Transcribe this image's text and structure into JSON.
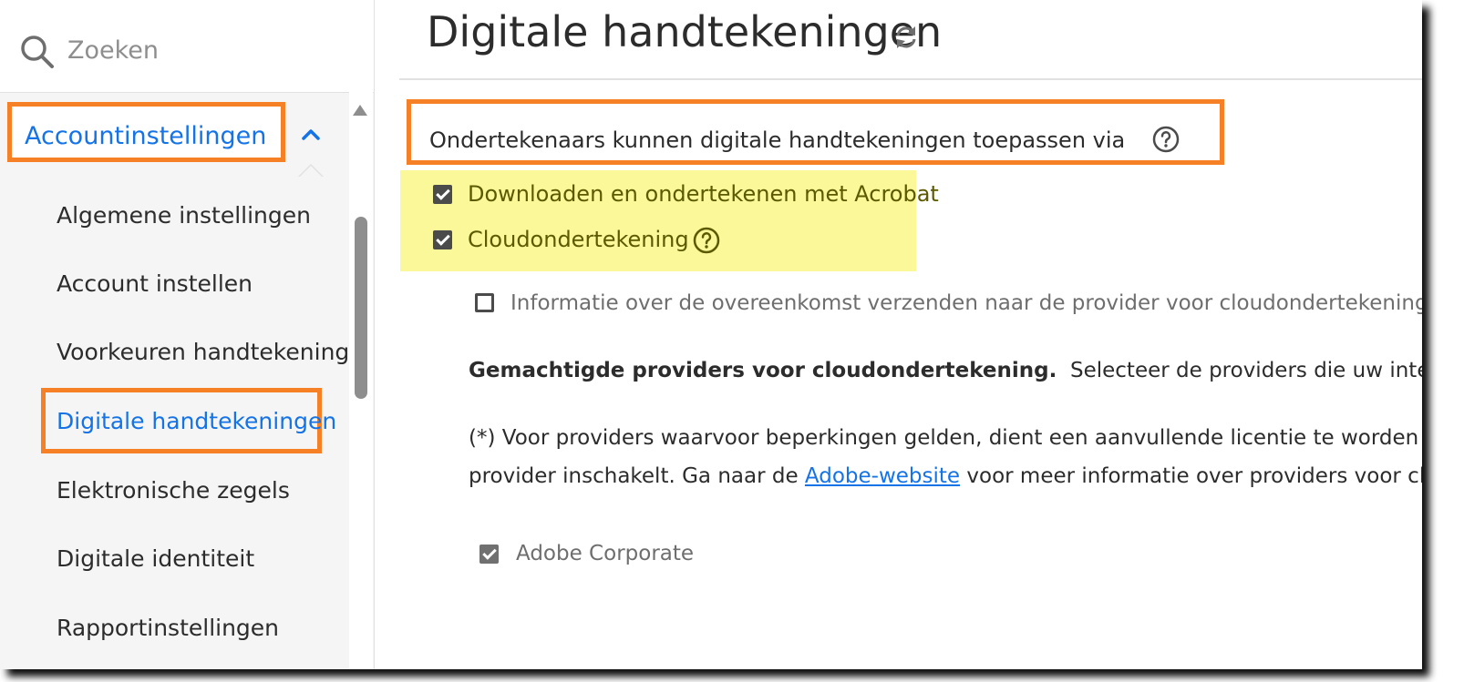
{
  "search": {
    "placeholder": "Zoeken"
  },
  "sidebar": {
    "section_label": "Accountinstellingen",
    "items": [
      {
        "label": "Algemene instellingen"
      },
      {
        "label": "Account instellen"
      },
      {
        "label": "Voorkeuren handtekening"
      },
      {
        "label": "Digitale handtekeningen",
        "active": true
      },
      {
        "label": "Elektronische zegels"
      },
      {
        "label": "Digitale identiteit"
      },
      {
        "label": "Rapportinstellingen"
      }
    ]
  },
  "main": {
    "title": "Digitale handtekeningen",
    "section_label": "Ondertekenaars kunnen digitale handtekeningen toepassen via",
    "options": [
      {
        "label": "Downloaden en ondertekenen met Acrobat",
        "checked": true
      },
      {
        "label": "Cloudondertekening",
        "checked": true
      }
    ],
    "sub_option": {
      "label": "Informatie over de overeenkomst verzenden naar de provider voor cloudondertekening",
      "checked": false
    },
    "providers_heading": "Gemachtigde providers voor cloudondertekening.",
    "providers_desc": "Selecteer de providers die uw interne c",
    "note_line1": "(*) Voor providers waarvoor beperkingen gelden, dient een aanvullende licentie te worden gea",
    "note_line2_before": "provider inschakelt. Ga naar de ",
    "note_link": "Adobe-website",
    "note_line2_after": " voor meer informatie over providers voor clou",
    "providers": [
      {
        "label": "Adobe Corporate",
        "checked": true
      }
    ]
  },
  "colors": {
    "accent": "#1473e6",
    "annotation_orange": "#f68026",
    "highlight_yellow": "#fbf89a"
  },
  "icons": [
    "search-icon",
    "chevron-up-icon",
    "refresh-icon",
    "help-icon",
    "checkbox-checked-icon",
    "checkbox-unchecked-icon"
  ]
}
